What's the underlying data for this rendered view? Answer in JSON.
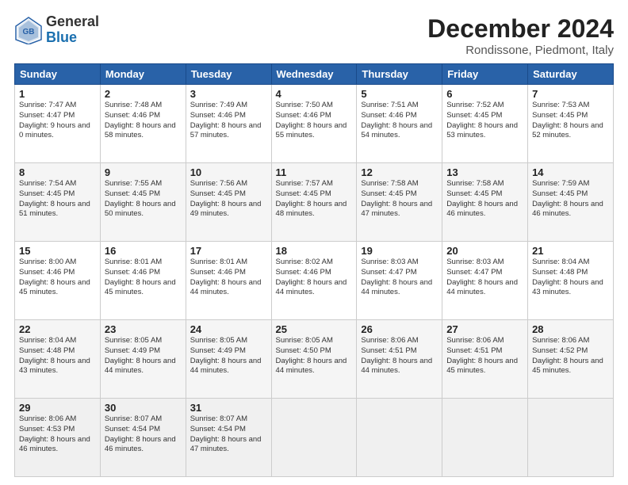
{
  "header": {
    "logo_general": "General",
    "logo_blue": "Blue",
    "month": "December 2024",
    "location": "Rondissone, Piedmont, Italy"
  },
  "days_of_week": [
    "Sunday",
    "Monday",
    "Tuesday",
    "Wednesday",
    "Thursday",
    "Friday",
    "Saturday"
  ],
  "weeks": [
    [
      {
        "day": "1",
        "sunrise": "Sunrise: 7:47 AM",
        "sunset": "Sunset: 4:47 PM",
        "daylight": "Daylight: 9 hours and 0 minutes."
      },
      {
        "day": "2",
        "sunrise": "Sunrise: 7:48 AM",
        "sunset": "Sunset: 4:46 PM",
        "daylight": "Daylight: 8 hours and 58 minutes."
      },
      {
        "day": "3",
        "sunrise": "Sunrise: 7:49 AM",
        "sunset": "Sunset: 4:46 PM",
        "daylight": "Daylight: 8 hours and 57 minutes."
      },
      {
        "day": "4",
        "sunrise": "Sunrise: 7:50 AM",
        "sunset": "Sunset: 4:46 PM",
        "daylight": "Daylight: 8 hours and 55 minutes."
      },
      {
        "day": "5",
        "sunrise": "Sunrise: 7:51 AM",
        "sunset": "Sunset: 4:46 PM",
        "daylight": "Daylight: 8 hours and 54 minutes."
      },
      {
        "day": "6",
        "sunrise": "Sunrise: 7:52 AM",
        "sunset": "Sunset: 4:45 PM",
        "daylight": "Daylight: 8 hours and 53 minutes."
      },
      {
        "day": "7",
        "sunrise": "Sunrise: 7:53 AM",
        "sunset": "Sunset: 4:45 PM",
        "daylight": "Daylight: 8 hours and 52 minutes."
      }
    ],
    [
      {
        "day": "8",
        "sunrise": "Sunrise: 7:54 AM",
        "sunset": "Sunset: 4:45 PM",
        "daylight": "Daylight: 8 hours and 51 minutes."
      },
      {
        "day": "9",
        "sunrise": "Sunrise: 7:55 AM",
        "sunset": "Sunset: 4:45 PM",
        "daylight": "Daylight: 8 hours and 50 minutes."
      },
      {
        "day": "10",
        "sunrise": "Sunrise: 7:56 AM",
        "sunset": "Sunset: 4:45 PM",
        "daylight": "Daylight: 8 hours and 49 minutes."
      },
      {
        "day": "11",
        "sunrise": "Sunrise: 7:57 AM",
        "sunset": "Sunset: 4:45 PM",
        "daylight": "Daylight: 8 hours and 48 minutes."
      },
      {
        "day": "12",
        "sunrise": "Sunrise: 7:58 AM",
        "sunset": "Sunset: 4:45 PM",
        "daylight": "Daylight: 8 hours and 47 minutes."
      },
      {
        "day": "13",
        "sunrise": "Sunrise: 7:58 AM",
        "sunset": "Sunset: 4:45 PM",
        "daylight": "Daylight: 8 hours and 46 minutes."
      },
      {
        "day": "14",
        "sunrise": "Sunrise: 7:59 AM",
        "sunset": "Sunset: 4:45 PM",
        "daylight": "Daylight: 8 hours and 46 minutes."
      }
    ],
    [
      {
        "day": "15",
        "sunrise": "Sunrise: 8:00 AM",
        "sunset": "Sunset: 4:46 PM",
        "daylight": "Daylight: 8 hours and 45 minutes."
      },
      {
        "day": "16",
        "sunrise": "Sunrise: 8:01 AM",
        "sunset": "Sunset: 4:46 PM",
        "daylight": "Daylight: 8 hours and 45 minutes."
      },
      {
        "day": "17",
        "sunrise": "Sunrise: 8:01 AM",
        "sunset": "Sunset: 4:46 PM",
        "daylight": "Daylight: 8 hours and 44 minutes."
      },
      {
        "day": "18",
        "sunrise": "Sunrise: 8:02 AM",
        "sunset": "Sunset: 4:46 PM",
        "daylight": "Daylight: 8 hours and 44 minutes."
      },
      {
        "day": "19",
        "sunrise": "Sunrise: 8:03 AM",
        "sunset": "Sunset: 4:47 PM",
        "daylight": "Daylight: 8 hours and 44 minutes."
      },
      {
        "day": "20",
        "sunrise": "Sunrise: 8:03 AM",
        "sunset": "Sunset: 4:47 PM",
        "daylight": "Daylight: 8 hours and 44 minutes."
      },
      {
        "day": "21",
        "sunrise": "Sunrise: 8:04 AM",
        "sunset": "Sunset: 4:48 PM",
        "daylight": "Daylight: 8 hours and 43 minutes."
      }
    ],
    [
      {
        "day": "22",
        "sunrise": "Sunrise: 8:04 AM",
        "sunset": "Sunset: 4:48 PM",
        "daylight": "Daylight: 8 hours and 43 minutes."
      },
      {
        "day": "23",
        "sunrise": "Sunrise: 8:05 AM",
        "sunset": "Sunset: 4:49 PM",
        "daylight": "Daylight: 8 hours and 44 minutes."
      },
      {
        "day": "24",
        "sunrise": "Sunrise: 8:05 AM",
        "sunset": "Sunset: 4:49 PM",
        "daylight": "Daylight: 8 hours and 44 minutes."
      },
      {
        "day": "25",
        "sunrise": "Sunrise: 8:05 AM",
        "sunset": "Sunset: 4:50 PM",
        "daylight": "Daylight: 8 hours and 44 minutes."
      },
      {
        "day": "26",
        "sunrise": "Sunrise: 8:06 AM",
        "sunset": "Sunset: 4:51 PM",
        "daylight": "Daylight: 8 hours and 44 minutes."
      },
      {
        "day": "27",
        "sunrise": "Sunrise: 8:06 AM",
        "sunset": "Sunset: 4:51 PM",
        "daylight": "Daylight: 8 hours and 45 minutes."
      },
      {
        "day": "28",
        "sunrise": "Sunrise: 8:06 AM",
        "sunset": "Sunset: 4:52 PM",
        "daylight": "Daylight: 8 hours and 45 minutes."
      }
    ],
    [
      {
        "day": "29",
        "sunrise": "Sunrise: 8:06 AM",
        "sunset": "Sunset: 4:53 PM",
        "daylight": "Daylight: 8 hours and 46 minutes."
      },
      {
        "day": "30",
        "sunrise": "Sunrise: 8:07 AM",
        "sunset": "Sunset: 4:54 PM",
        "daylight": "Daylight: 8 hours and 46 minutes."
      },
      {
        "day": "31",
        "sunrise": "Sunrise: 8:07 AM",
        "sunset": "Sunset: 4:54 PM",
        "daylight": "Daylight: 8 hours and 47 minutes."
      },
      null,
      null,
      null,
      null
    ]
  ]
}
